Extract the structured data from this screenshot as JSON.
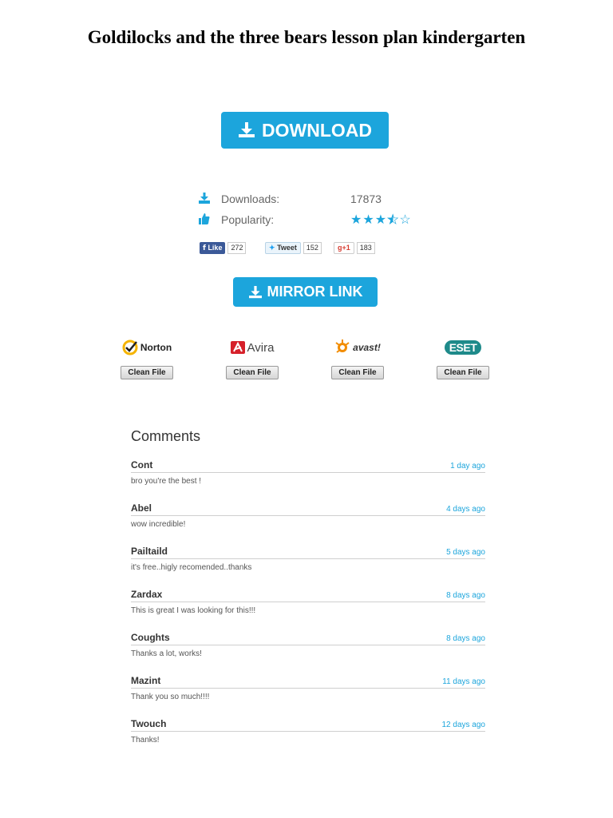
{
  "title": "Goldilocks and the three bears lesson plan kindergarten",
  "download_button": "DOWNLOAD",
  "stats": {
    "downloads_label": "Downloads:",
    "downloads_value": "17873",
    "popularity_label": "Popularity:",
    "rating": 3.5,
    "rating_max": 5
  },
  "social": {
    "like_label": "Like",
    "like_count": "272",
    "tweet_label": "Tweet",
    "tweet_count": "152",
    "gplus_label": "+1",
    "gplus_count": "183"
  },
  "mirror_button": "MIRROR LINK",
  "antivirus": [
    {
      "name": "Norton",
      "button": "Clean File"
    },
    {
      "name": "Avira",
      "button": "Clean File"
    },
    {
      "name": "avast!",
      "button": "Clean File"
    },
    {
      "name": "eset",
      "button": "Clean File"
    }
  ],
  "comments_title": "Comments",
  "comments": [
    {
      "author": "Cont",
      "time": "1 day ago",
      "text": "bro you're the best !"
    },
    {
      "author": "Abel",
      "time": "4 days ago",
      "text": "wow incredible!"
    },
    {
      "author": "Pailtaild",
      "time": "5 days ago",
      "text": "it's free..higly recomended..thanks"
    },
    {
      "author": "Zardax",
      "time": "8 days ago",
      "text": "This is great I was looking for this!!!"
    },
    {
      "author": "Coughts",
      "time": "8 days ago",
      "text": "Thanks a lot, works!"
    },
    {
      "author": "Mazint",
      "time": "11 days ago",
      "text": "Thank you so much!!!!"
    },
    {
      "author": "Twouch",
      "time": "12 days ago",
      "text": "Thanks!"
    }
  ],
  "colors": {
    "accent": "#1ca5dc",
    "facebook": "#3b5998"
  }
}
